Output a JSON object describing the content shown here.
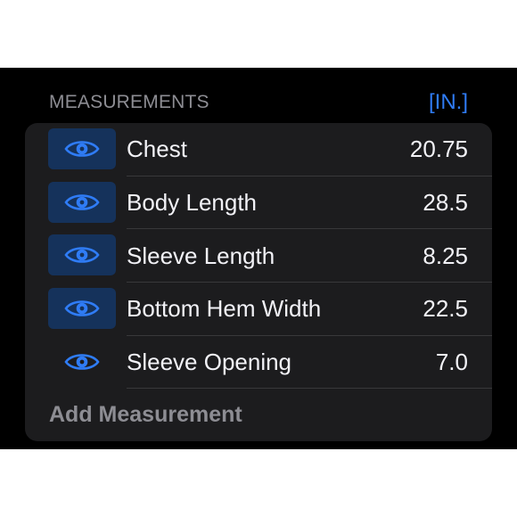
{
  "header": {
    "title": "MEASUREMENTS",
    "unit_label": "[IN.]"
  },
  "colors": {
    "accent": "#2f7cf6",
    "card_background": "#1c1c1e",
    "eye_highlight": "#15325b"
  },
  "measurements": [
    {
      "label": "Chest",
      "value": "20.75",
      "icon": "eye-icon",
      "highlighted": true
    },
    {
      "label": "Body Length",
      "value": "28.5",
      "icon": "eye-icon",
      "highlighted": true
    },
    {
      "label": "Sleeve Length",
      "value": "8.25",
      "icon": "eye-icon",
      "highlighted": true
    },
    {
      "label": "Bottom Hem Width",
      "value": "22.5",
      "icon": "eye-icon",
      "highlighted": true
    },
    {
      "label": "Sleeve Opening",
      "value": "7.0",
      "icon": "eye-icon",
      "highlighted": false
    }
  ],
  "add_label": "Add Measurement"
}
